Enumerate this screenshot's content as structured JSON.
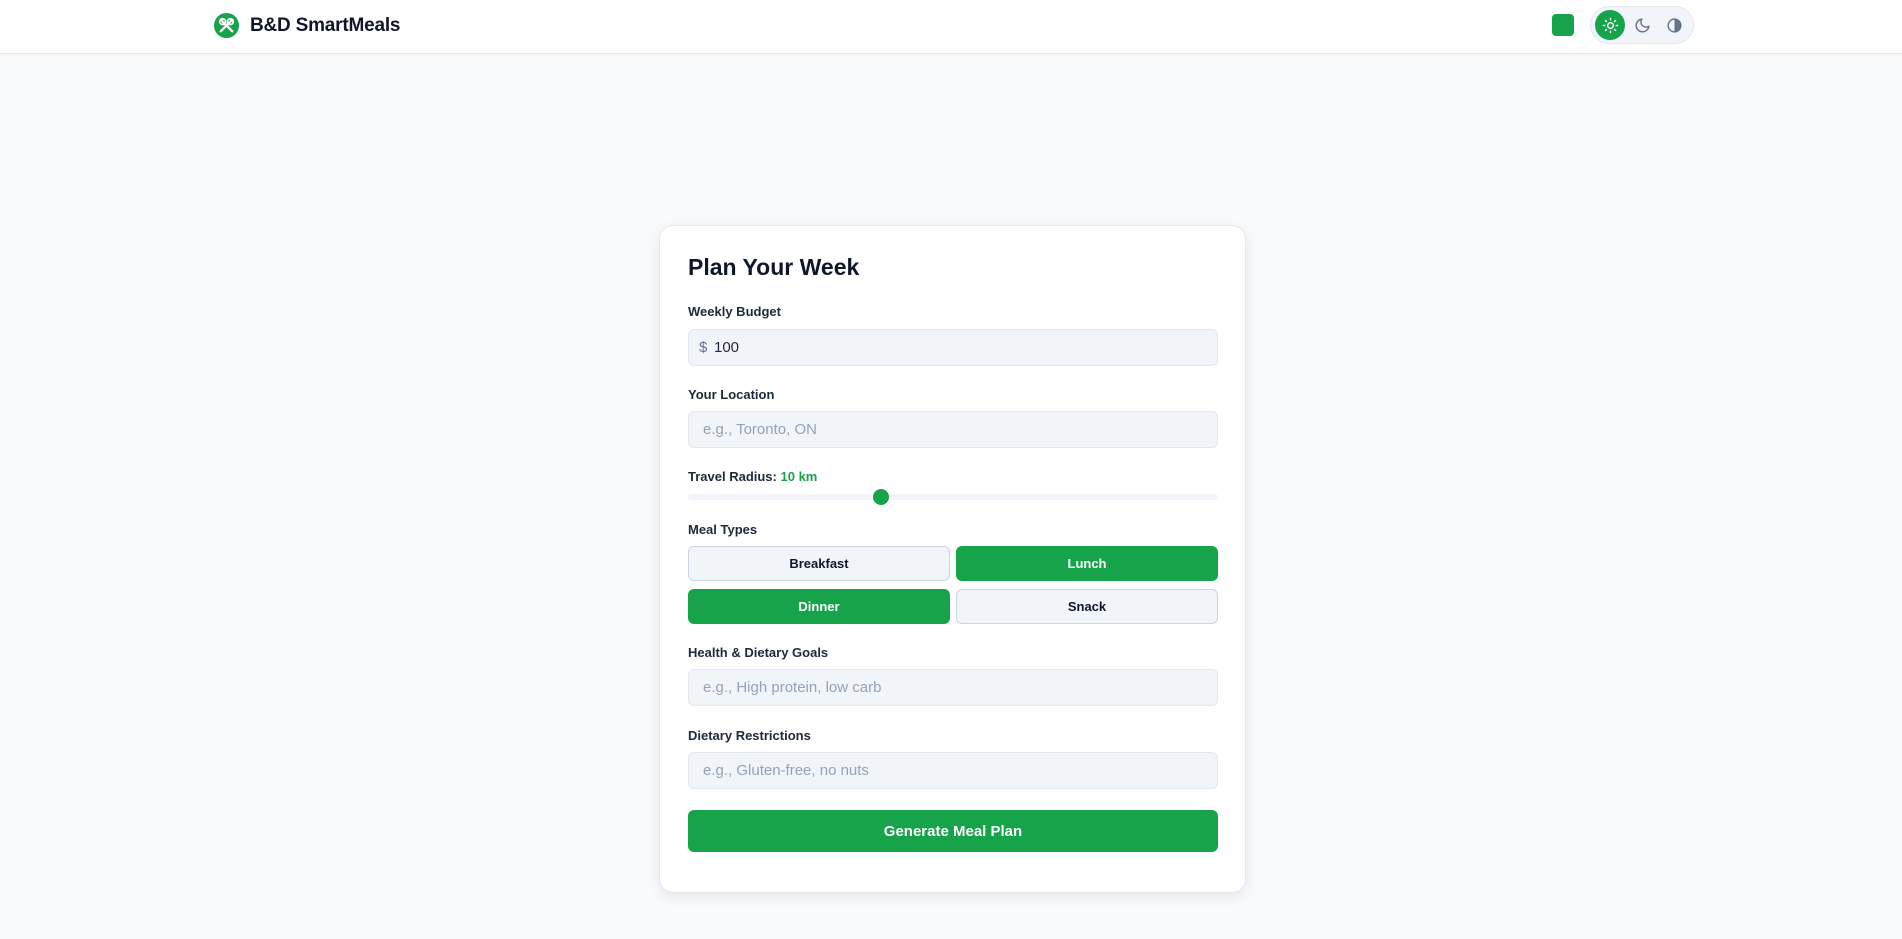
{
  "header": {
    "brand_name": "B&D SmartMeals",
    "logo_icon": "crossed-utensils-icon",
    "accent_color": "#16a34a",
    "theme_toggle": {
      "options": [
        "light",
        "dark",
        "contrast"
      ],
      "selected": "light"
    }
  },
  "form": {
    "title": "Plan Your Week",
    "budget": {
      "label": "Weekly Budget",
      "currency_symbol": "$",
      "value": "100"
    },
    "location": {
      "label": "Your Location",
      "value": "",
      "placeholder": "e.g., Toronto, ON"
    },
    "radius": {
      "label": "Travel Radius:",
      "value_text": "10 km",
      "value": 10,
      "min": 1,
      "max": 26
    },
    "meal_types": {
      "label": "Meal Types",
      "options": [
        {
          "label": "Breakfast",
          "selected": false
        },
        {
          "label": "Lunch",
          "selected": true
        },
        {
          "label": "Dinner",
          "selected": true
        },
        {
          "label": "Snack",
          "selected": false
        }
      ]
    },
    "goals": {
      "label": "Health & Dietary Goals",
      "value": "",
      "placeholder": "e.g., High protein, low carb"
    },
    "restrictions": {
      "label": "Dietary Restrictions",
      "value": "",
      "placeholder": "e.g., Gluten-free, no nuts"
    },
    "submit_label": "Generate Meal Plan"
  }
}
